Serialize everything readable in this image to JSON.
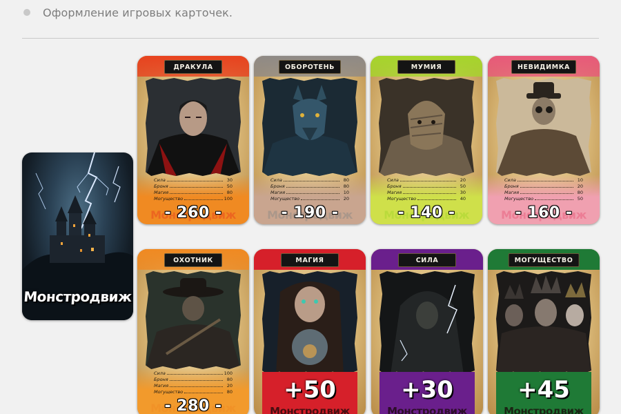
{
  "caption": "Оформление игровых карточек.",
  "cover": {
    "title": "Монстродвиж"
  },
  "cards": [
    {
      "name": "ДРАКУЛА",
      "accent": "#e8431f",
      "panel": "#f08a22",
      "stats": [
        {
          "label": "Сила",
          "value": "30"
        },
        {
          "label": "Броня",
          "value": "50"
        },
        {
          "label": "Магия",
          "value": "80"
        },
        {
          "label": "Могущество",
          "value": "100"
        }
      ],
      "total": "- 260 -",
      "ghost": "Монстродвиж"
    },
    {
      "name": "ОБОРОТЕНЬ",
      "accent": "#8f8a86",
      "panel": "#c9a58f",
      "stats": [
        {
          "label": "Сила",
          "value": "80"
        },
        {
          "label": "Броня",
          "value": "80"
        },
        {
          "label": "Магия",
          "value": "10"
        },
        {
          "label": "Могущество",
          "value": "20"
        }
      ],
      "total": "- 190 -",
      "ghost": "Монстродвиж"
    },
    {
      "name": "МУМИЯ",
      "accent": "#a6d52c",
      "panel": "#cfe04a",
      "stats": [
        {
          "label": "Сила",
          "value": "20"
        },
        {
          "label": "Броня",
          "value": "50"
        },
        {
          "label": "Магия",
          "value": "30"
        },
        {
          "label": "Могущество",
          "value": "40"
        }
      ],
      "total": "- 140 -",
      "ghost": "Монстродвиж"
    },
    {
      "name": "НЕВИДИМКА",
      "accent": "#e85a7a",
      "panel": "#f0a0b0",
      "stats": [
        {
          "label": "Сила",
          "value": "10"
        },
        {
          "label": "Броня",
          "value": "20"
        },
        {
          "label": "Магия",
          "value": "80"
        },
        {
          "label": "Могущество",
          "value": "50"
        }
      ],
      "total": "- 160 -",
      "ghost": "Монстродвиж"
    },
    {
      "name": "ОХОТНИК",
      "accent": "#f08a22",
      "panel": "#f29a2c",
      "stats": [
        {
          "label": "Сила",
          "value": "100"
        },
        {
          "label": "Броня",
          "value": "80"
        },
        {
          "label": "Магия",
          "value": "20"
        },
        {
          "label": "Могущество",
          "value": "80"
        }
      ],
      "total": "- 280 -",
      "ghost": "Монстродвиж"
    }
  ],
  "bonus_cards": [
    {
      "name": "МАГИЯ",
      "accent": "#d6202a",
      "value": "+50",
      "ghost": "Монстродвиж"
    },
    {
      "name": "СИЛА",
      "accent": "#6a1f8c",
      "value": "+30",
      "ghost": "Монстродвиж"
    },
    {
      "name": "МОГУЩЕСТВО",
      "accent": "#1f7a36",
      "value": "+45",
      "ghost": "Монстродвиж"
    }
  ]
}
